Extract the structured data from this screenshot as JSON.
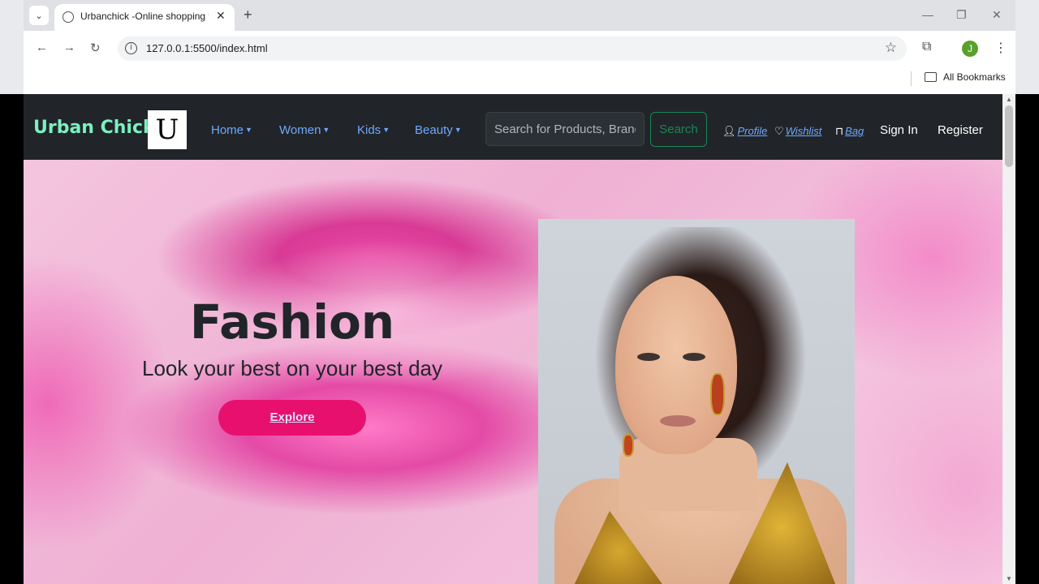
{
  "browser": {
    "tab_title": "Urbanchick -Online shopping f",
    "url": "127.0.0.1:5500/index.html",
    "bookmarks_label": "All Bookmarks",
    "profile_initial": "J",
    "new_tab_symbol": "+",
    "tab_close_symbol": "✕",
    "tab_dropdown_symbol": "⌄"
  },
  "navbar": {
    "brand": "Urban Chick",
    "logo_letter": "U",
    "menu": [
      {
        "label": "Home"
      },
      {
        "label": "Women"
      },
      {
        "label": "Kids"
      },
      {
        "label": "Beauty"
      }
    ],
    "search_placeholder": "Search for Products, Brands and More",
    "search_button": "Search",
    "profile": "Profile",
    "wishlist": "Wishlist",
    "bag": "Bag",
    "sign_in": "Sign In",
    "register": "Register"
  },
  "hero": {
    "title": "Fashion",
    "subtitle": "Look your best on your best day",
    "button": "Explore"
  },
  "colors": {
    "navbar_bg": "#212529",
    "brand": "#7cf0c0",
    "link": "#6ea8fe",
    "search_button": "#198754",
    "explore_button": "#e8106e"
  }
}
